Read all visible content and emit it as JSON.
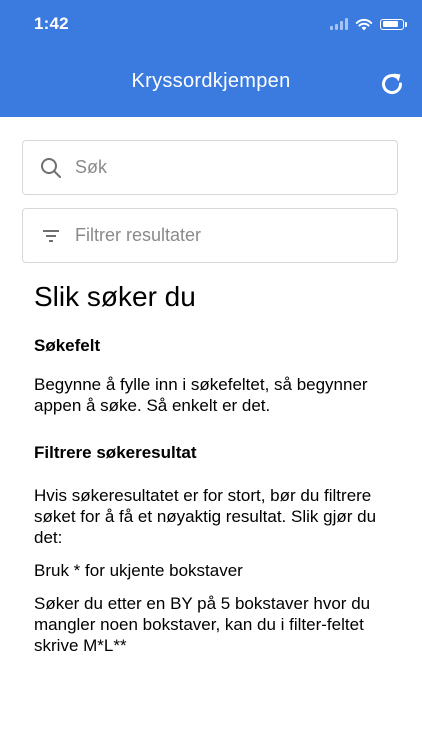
{
  "status_bar": {
    "time": "1:42",
    "icons": [
      "signal-icon",
      "wifi-icon",
      "battery-icon"
    ],
    "battery_level": 0.85
  },
  "header": {
    "title": "Kryssordkjempen",
    "background_color": "#3b7be0",
    "refresh_icon": "refresh-icon"
  },
  "search": {
    "placeholder": "Søk",
    "icon": "search-icon"
  },
  "filter": {
    "placeholder": "Filtrer resultater",
    "icon": "filter-icon"
  },
  "help": {
    "title": "Slik søker du",
    "section1_heading": "Søkefelt",
    "section1_text": "Begynne å fylle inn i søkefeltet, så begynner appen å søke. Så enkelt er det.",
    "section2_heading": "Filtrere søkeresultat",
    "section2_text": "Hvis søkeresultatet er for stort, bør du filtrere søket for å få et nøyaktig resultat. Slik gjør du det:",
    "section2_tip": "Bruk * for ukjente bokstaver",
    "section2_example": "Søker du etter en BY på 5 bokstaver hvor du mangler noen bokstaver,  kan du i filter-feltet skrive M*L**"
  }
}
